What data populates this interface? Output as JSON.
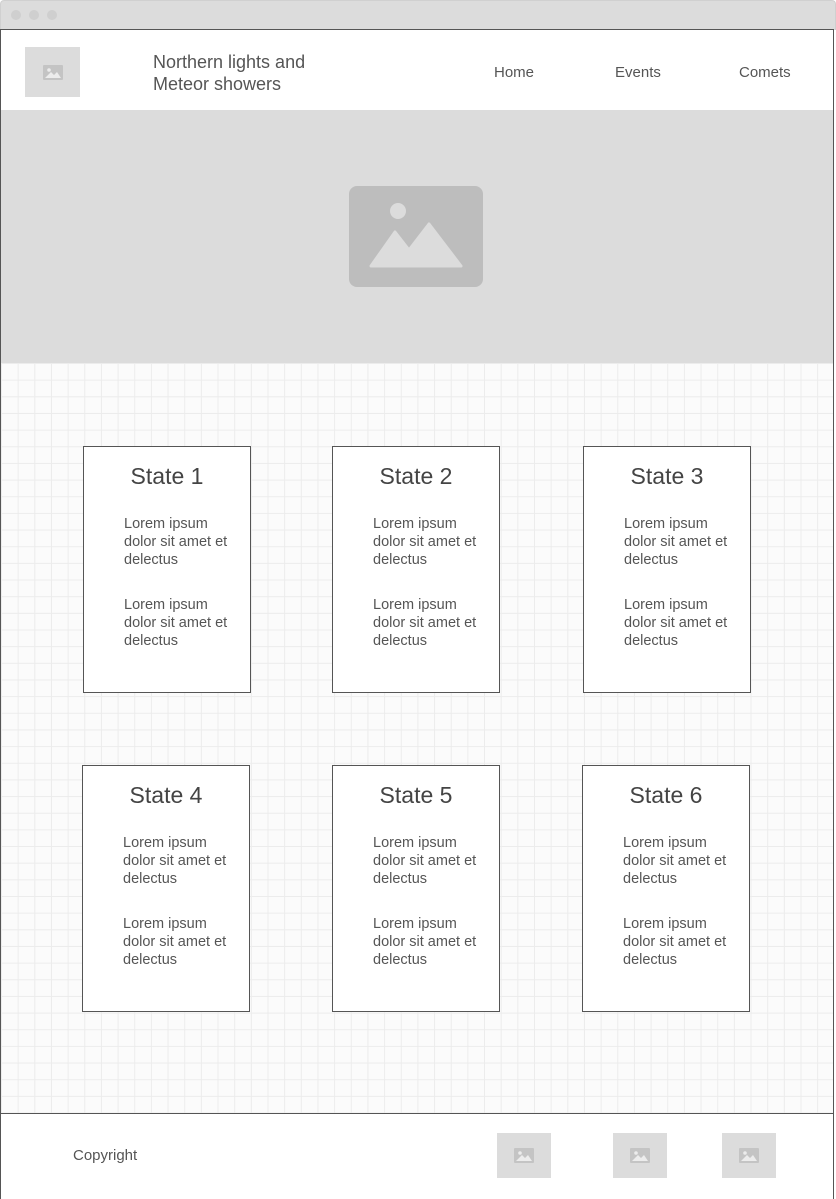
{
  "header": {
    "title": "Northern lights and Meteor showers",
    "logo_icon": "image-placeholder-icon",
    "nav": [
      "Home",
      "Events",
      "Comets"
    ]
  },
  "hero": {
    "icon": "image-placeholder-icon"
  },
  "cards": [
    {
      "title": "State 1",
      "p1": "Lorem ipsum dolor sit amet et delectus",
      "p2": "Lorem ipsum dolor sit amet et delectus"
    },
    {
      "title": "State 2",
      "p1": "Lorem ipsum dolor sit amet et delectus",
      "p2": "Lorem ipsum dolor sit amet et delectus"
    },
    {
      "title": "State 3",
      "p1": "Lorem ipsum dolor sit amet et delectus",
      "p2": "Lorem ipsum dolor sit amet et delectus"
    },
    {
      "title": "State 4",
      "p1": "Lorem ipsum dolor sit amet et delectus",
      "p2": "Lorem ipsum dolor sit amet et delectus"
    },
    {
      "title": "State 5",
      "p1": "Lorem ipsum dolor sit amet et delectus",
      "p2": "Lorem ipsum dolor sit amet et delectus"
    },
    {
      "title": "State 6",
      "p1": "Lorem ipsum dolor sit amet et delectus",
      "p2": "Lorem ipsum dolor sit amet et delectus"
    }
  ],
  "footer": {
    "copyright": "Copyright",
    "icons": [
      "image-placeholder-icon",
      "image-placeholder-icon",
      "image-placeholder-icon"
    ]
  },
  "colors": {
    "placeholder": "#dcdcdc",
    "placeholder_dark": "#bdbdbd",
    "border": "#555555",
    "text": "#444444"
  }
}
